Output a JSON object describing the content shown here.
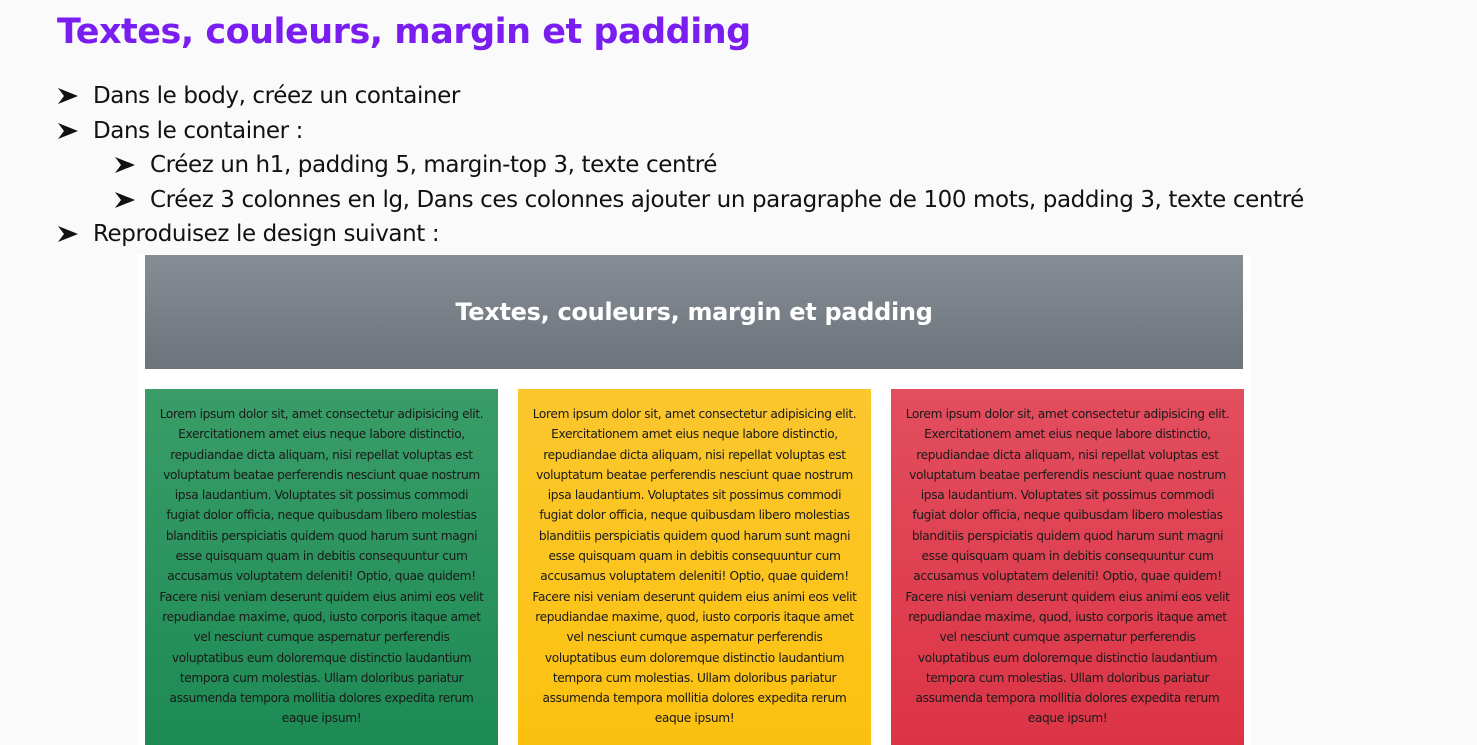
{
  "slide": {
    "title": "Textes, couleurs, margin et padding",
    "bullets": [
      "Dans le body, créez un container",
      "Dans le container :",
      "Créez un h1, padding 5, margin-top 3, texte centré",
      "Créez 3 colonnes en lg, Dans ces colonnes ajouter un paragraphe de 100 mots, padding 3, texte centré",
      "Reproduisez le design suivant :"
    ],
    "bullet_icon": "arrowhead-bullet-icon"
  },
  "demo": {
    "header_title": "Textes, couleurs, margin et padding",
    "header_color": "#6c737b",
    "columns": [
      {
        "color": "#1d8a54",
        "text": "Lorem ipsum dolor sit, amet consectetur adipisicing elit. Exercitationem amet eius neque labore distinctio, repudiandae dicta aliquam, nisi repellat voluptas est voluptatum beatae perferendis nesciunt quae nostrum ipsa laudantium. Voluptates sit possimus commodi fugiat dolor officia, neque quibusdam libero molestias blanditiis perspiciatis quidem quod harum sunt magni esse quisquam quam in debitis consequuntur cum accusamus voluptatem deleniti! Optio, quae quidem! Facere nisi veniam deserunt quidem eius animi eos velit repudiandae maxime, quod, iusto corporis itaque amet vel nesciunt cumque aspernatur perferendis voluptatibus eum doloremque distinctio laudantium tempora cum molestias. Ullam doloribus pariatur assumenda tempora mollitia dolores expedita rerum eaque ipsum!"
      },
      {
        "color": "#fcc10f",
        "text": "Lorem ipsum dolor sit, amet consectetur adipisicing elit. Exercitationem amet eius neque labore distinctio, repudiandae dicta aliquam, nisi repellat voluptas est voluptatum beatae perferendis nesciunt quae nostrum ipsa laudantium. Voluptates sit possimus commodi fugiat dolor officia, neque quibusdam libero molestias blanditiis perspiciatis quidem quod harum sunt magni esse quisquam quam in debitis consequuntur cum accusamus voluptatem deleniti! Optio, quae quidem! Facere nisi veniam deserunt quidem eius animi eos velit repudiandae maxime, quod, iusto corporis itaque amet vel nesciunt cumque aspernatur perferendis voluptatibus eum doloremque distinctio laudantium tempora cum molestias. Ullam doloribus pariatur assumenda tempora mollitia dolores expedita rerum eaque ipsum!"
      },
      {
        "color": "#dc3446",
        "text": "Lorem ipsum dolor sit, amet consectetur adipisicing elit. Exercitationem amet eius neque labore distinctio, repudiandae dicta aliquam, nisi repellat voluptas est voluptatum beatae perferendis nesciunt quae nostrum ipsa laudantium. Voluptates sit possimus commodi fugiat dolor officia, neque quibusdam libero molestias blanditiis perspiciatis quidem quod harum sunt magni esse quisquam quam in debitis consequuntur cum accusamus voluptatem deleniti! Optio, quae quidem! Facere nisi veniam deserunt quidem eius animi eos velit repudiandae maxime, quod, iusto corporis itaque amet vel nesciunt cumque aspernatur perferendis voluptatibus eum doloremque distinctio laudantium tempora cum molestias. Ullam doloribus pariatur assumenda tempora mollitia dolores expedita rerum eaque ipsum!"
      }
    ]
  },
  "colors": {
    "title": "#7a1df0",
    "text": "#111111",
    "background": "#fafafa"
  }
}
